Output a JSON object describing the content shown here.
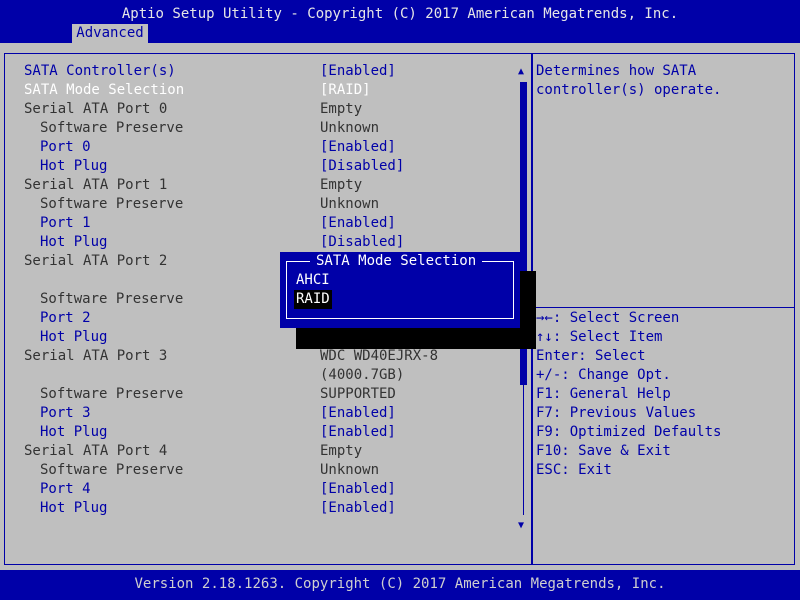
{
  "header": {
    "title": "Aptio Setup Utility - Copyright (C) 2017 American Megatrends, Inc.",
    "tab": "Advanced"
  },
  "settings": [
    {
      "label": "SATA Controller(s)",
      "value": "[Enabled]"
    },
    {
      "label": "SATA Mode Selection",
      "value": "[RAID]"
    },
    {
      "label": "Serial ATA Port 0",
      "value": "Empty"
    },
    {
      "label": "Software Preserve",
      "value": "Unknown"
    },
    {
      "label": "Port 0",
      "value": "[Enabled]"
    },
    {
      "label": "Hot Plug",
      "value": "[Disabled]"
    },
    {
      "label": "Serial ATA Port 1",
      "value": "Empty"
    },
    {
      "label": "Software Preserve",
      "value": "Unknown"
    },
    {
      "label": "Port 1",
      "value": "[Enabled]"
    },
    {
      "label": "Hot Plug",
      "value": "[Disabled]"
    },
    {
      "label": "Serial ATA Port 2",
      "value": ""
    },
    {
      "label": "Software Preserve",
      "value": ""
    },
    {
      "label": "Port 2",
      "value": ""
    },
    {
      "label": "Hot Plug",
      "value": ""
    },
    {
      "label": "Serial ATA Port 3",
      "value": "WDC WD40EJRX-8",
      "value2": "(4000.7GB)"
    },
    {
      "label": "Software Preserve",
      "value": "SUPPORTED"
    },
    {
      "label": "Port 3",
      "value": "[Enabled]"
    },
    {
      "label": "Hot Plug",
      "value": "[Enabled]"
    },
    {
      "label": "Serial ATA Port 4",
      "value": "Empty"
    },
    {
      "label": "Software Preserve",
      "value": "Unknown"
    },
    {
      "label": "Port 4",
      "value": "[Enabled]"
    },
    {
      "label": "Hot Plug",
      "value": "[Enabled]"
    }
  ],
  "help": {
    "line1": "Determines how SATA",
    "line2": "controller(s) operate."
  },
  "keys": [
    "→←: Select Screen",
    "↑↓: Select Item",
    "Enter: Select",
    "+/-: Change Opt.",
    "F1: General Help",
    "F7: Previous Values",
    "F9: Optimized Defaults",
    "F10: Save & Exit",
    "ESC: Exit"
  ],
  "popup": {
    "title": "SATA Mode Selection",
    "options": [
      "AHCI",
      "RAID"
    ],
    "selected": "RAID"
  },
  "footer": "Version 2.18.1263. Copyright (C) 2017 American Megatrends, Inc.",
  "colors": {
    "background": "#bfbfbf",
    "accent_blue": "#0000a8",
    "highlight_white": "#ffffff"
  }
}
